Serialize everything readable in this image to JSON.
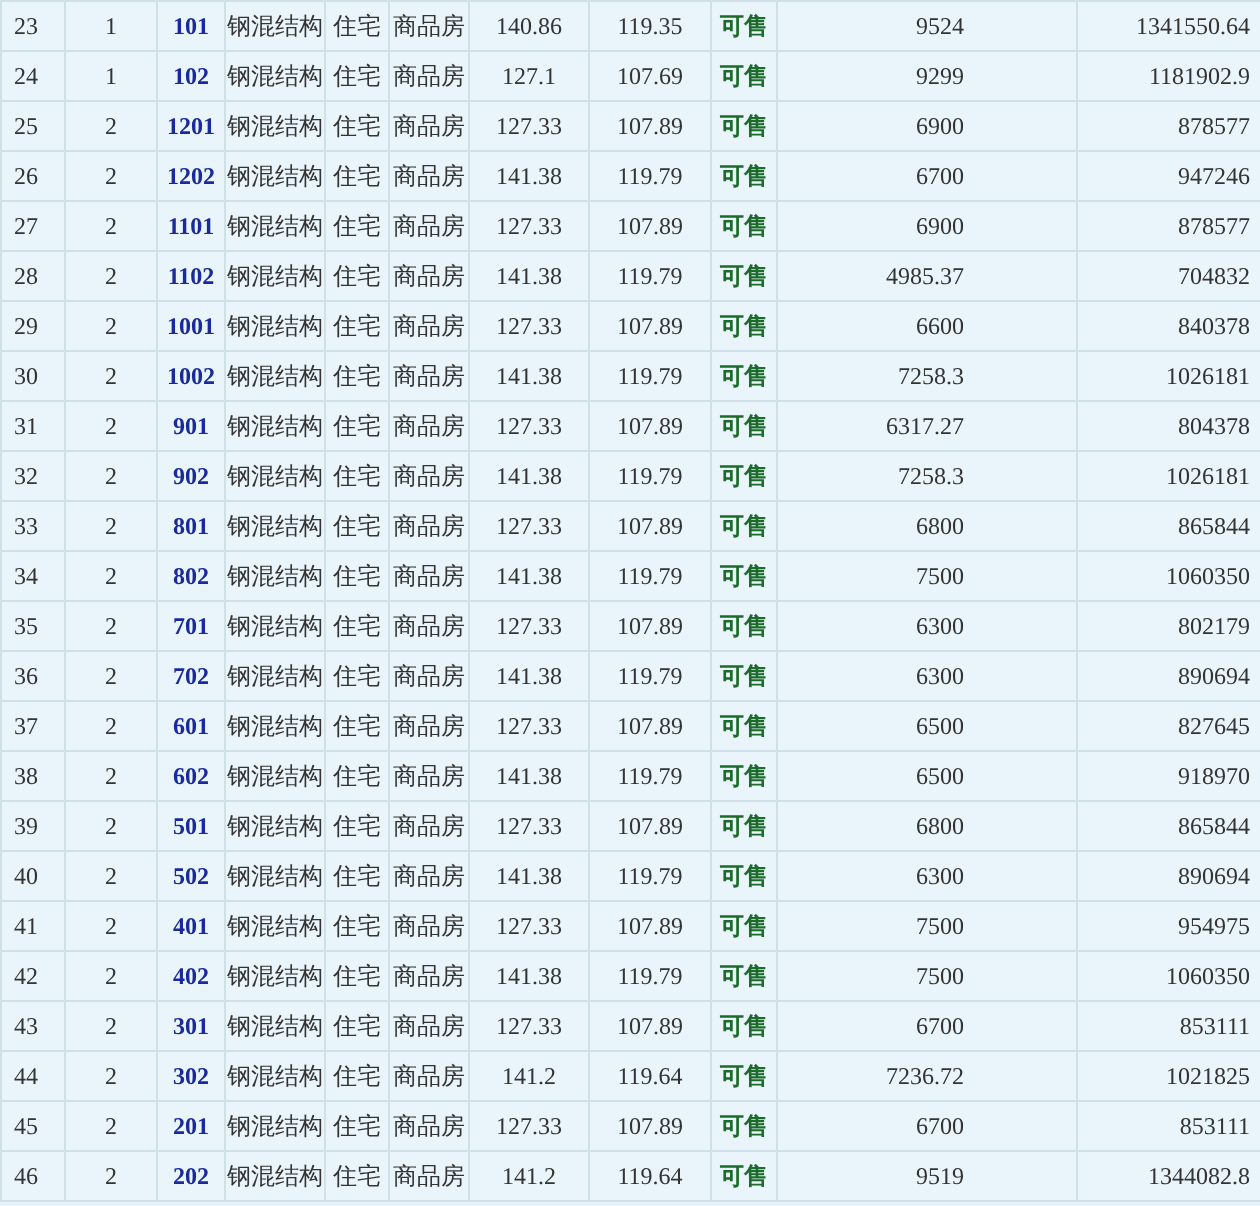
{
  "table": {
    "rows": [
      {
        "cells": [
          "23",
          "1",
          "101",
          "钢混结构",
          "住宅",
          "商品房",
          "140.86",
          "119.35",
          "可售",
          "9524",
          "1341550.64"
        ]
      },
      {
        "cells": [
          "24",
          "1",
          "102",
          "钢混结构",
          "住宅",
          "商品房",
          "127.1",
          "107.69",
          "可售",
          "9299",
          "1181902.9"
        ]
      },
      {
        "cells": [
          "25",
          "2",
          "1201",
          "钢混结构",
          "住宅",
          "商品房",
          "127.33",
          "107.89",
          "可售",
          "6900",
          "878577"
        ]
      },
      {
        "cells": [
          "26",
          "2",
          "1202",
          "钢混结构",
          "住宅",
          "商品房",
          "141.38",
          "119.79",
          "可售",
          "6700",
          "947246"
        ]
      },
      {
        "cells": [
          "27",
          "2",
          "1101",
          "钢混结构",
          "住宅",
          "商品房",
          "127.33",
          "107.89",
          "可售",
          "6900",
          "878577"
        ]
      },
      {
        "cells": [
          "28",
          "2",
          "1102",
          "钢混结构",
          "住宅",
          "商品房",
          "141.38",
          "119.79",
          "可售",
          "4985.37",
          "704832"
        ]
      },
      {
        "cells": [
          "29",
          "2",
          "1001",
          "钢混结构",
          "住宅",
          "商品房",
          "127.33",
          "107.89",
          "可售",
          "6600",
          "840378"
        ]
      },
      {
        "cells": [
          "30",
          "2",
          "1002",
          "钢混结构",
          "住宅",
          "商品房",
          "141.38",
          "119.79",
          "可售",
          "7258.3",
          "1026181"
        ]
      },
      {
        "cells": [
          "31",
          "2",
          "901",
          "钢混结构",
          "住宅",
          "商品房",
          "127.33",
          "107.89",
          "可售",
          "6317.27",
          "804378"
        ]
      },
      {
        "cells": [
          "32",
          "2",
          "902",
          "钢混结构",
          "住宅",
          "商品房",
          "141.38",
          "119.79",
          "可售",
          "7258.3",
          "1026181"
        ]
      },
      {
        "cells": [
          "33",
          "2",
          "801",
          "钢混结构",
          "住宅",
          "商品房",
          "127.33",
          "107.89",
          "可售",
          "6800",
          "865844"
        ]
      },
      {
        "cells": [
          "34",
          "2",
          "802",
          "钢混结构",
          "住宅",
          "商品房",
          "141.38",
          "119.79",
          "可售",
          "7500",
          "1060350"
        ]
      },
      {
        "cells": [
          "35",
          "2",
          "701",
          "钢混结构",
          "住宅",
          "商品房",
          "127.33",
          "107.89",
          "可售",
          "6300",
          "802179"
        ]
      },
      {
        "cells": [
          "36",
          "2",
          "702",
          "钢混结构",
          "住宅",
          "商品房",
          "141.38",
          "119.79",
          "可售",
          "6300",
          "890694"
        ]
      },
      {
        "cells": [
          "37",
          "2",
          "601",
          "钢混结构",
          "住宅",
          "商品房",
          "127.33",
          "107.89",
          "可售",
          "6500",
          "827645"
        ]
      },
      {
        "cells": [
          "38",
          "2",
          "602",
          "钢混结构",
          "住宅",
          "商品房",
          "141.38",
          "119.79",
          "可售",
          "6500",
          "918970"
        ]
      },
      {
        "cells": [
          "39",
          "2",
          "501",
          "钢混结构",
          "住宅",
          "商品房",
          "127.33",
          "107.89",
          "可售",
          "6800",
          "865844"
        ]
      },
      {
        "cells": [
          "40",
          "2",
          "502",
          "钢混结构",
          "住宅",
          "商品房",
          "141.38",
          "119.79",
          "可售",
          "6300",
          "890694"
        ]
      },
      {
        "cells": [
          "41",
          "2",
          "401",
          "钢混结构",
          "住宅",
          "商品房",
          "127.33",
          "107.89",
          "可售",
          "7500",
          "954975"
        ]
      },
      {
        "cells": [
          "42",
          "2",
          "402",
          "钢混结构",
          "住宅",
          "商品房",
          "141.38",
          "119.79",
          "可售",
          "7500",
          "1060350"
        ]
      },
      {
        "cells": [
          "43",
          "2",
          "301",
          "钢混结构",
          "住宅",
          "商品房",
          "127.33",
          "107.89",
          "可售",
          "6700",
          "853111"
        ]
      },
      {
        "cells": [
          "44",
          "2",
          "302",
          "钢混结构",
          "住宅",
          "商品房",
          "141.2",
          "119.64",
          "可售",
          "7236.72",
          "1021825"
        ]
      },
      {
        "cells": [
          "45",
          "2",
          "201",
          "钢混结构",
          "住宅",
          "商品房",
          "127.33",
          "107.89",
          "可售",
          "6700",
          "853111"
        ]
      },
      {
        "cells": [
          "46",
          "2",
          "202",
          "钢混结构",
          "住宅",
          "商品房",
          "141.2",
          "119.64",
          "可售",
          "9519",
          "1344082.8"
        ]
      }
    ]
  }
}
